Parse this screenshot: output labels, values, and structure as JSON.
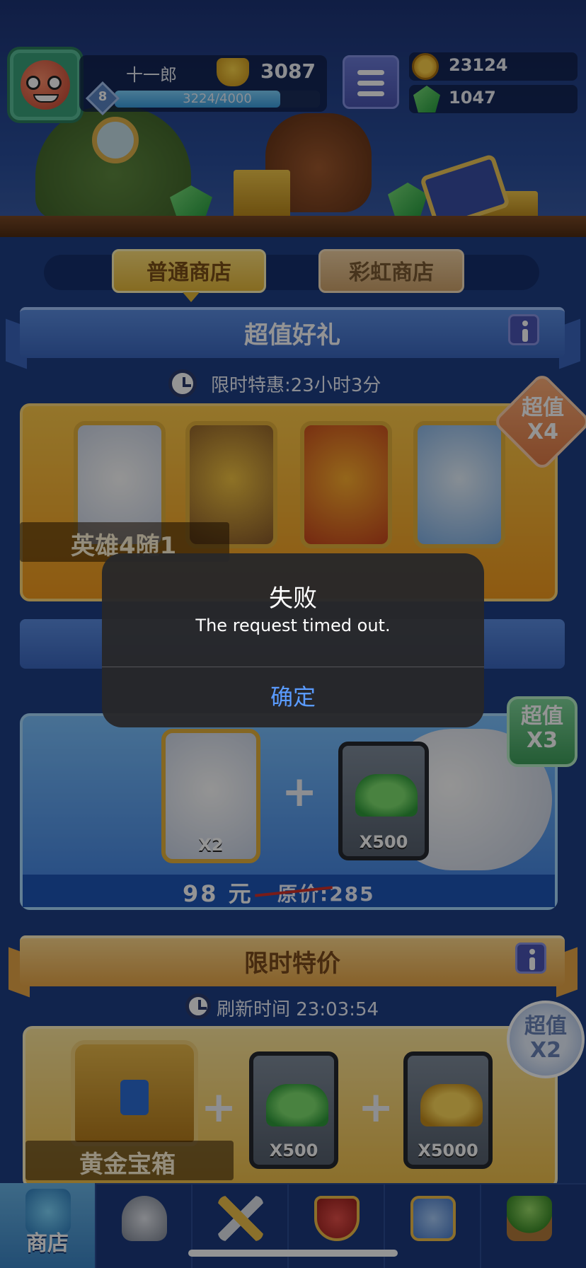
{
  "player": {
    "name": "十一郎",
    "trophies": "3087",
    "level": "8",
    "xp_text": "3224/4000",
    "xp_fraction": 0.806
  },
  "currency": {
    "coins": "23124",
    "gems": "1047"
  },
  "tabs": [
    {
      "label": "普通商店",
      "active": true
    },
    {
      "label": "彩虹商店",
      "active": false
    }
  ],
  "section_gift": {
    "title": "超值好礼",
    "timer": "限时特惠:23小时3分"
  },
  "offer_heroes": {
    "label": "英雄4随1",
    "badge_line1": "超值",
    "badge_line2": "X4"
  },
  "offer_bundle": {
    "badge_line1": "超值",
    "badge_line2": "X3",
    "hero_qty": "X2",
    "gem_qty": "X500",
    "price": "98 元",
    "original_price": "原价:285"
  },
  "section_limited": {
    "title": "限时特价",
    "timer": "刷新时间 23:03:54",
    "badge_line1": "超值",
    "badge_line2": "X2",
    "chest_label": "黄金宝箱",
    "gem_qty": "X500",
    "coin_qty": "X5000"
  },
  "bottom_nav": {
    "shop_label": "商店"
  },
  "alert": {
    "title": "失败",
    "message": "The request timed out.",
    "button": "确定"
  },
  "colors": {
    "alert_button": "#5a9bff",
    "background": "#1e3f86"
  },
  "icons": [
    "avatar-icon",
    "trophy-icon",
    "level-badge-icon",
    "menu-icon",
    "coin-icon",
    "gem-icon",
    "clock-icon",
    "info-icon",
    "shop-icon",
    "helmet-icon",
    "swords-icon",
    "shield-crown-icon",
    "friends-icon",
    "sprout-icon"
  ]
}
